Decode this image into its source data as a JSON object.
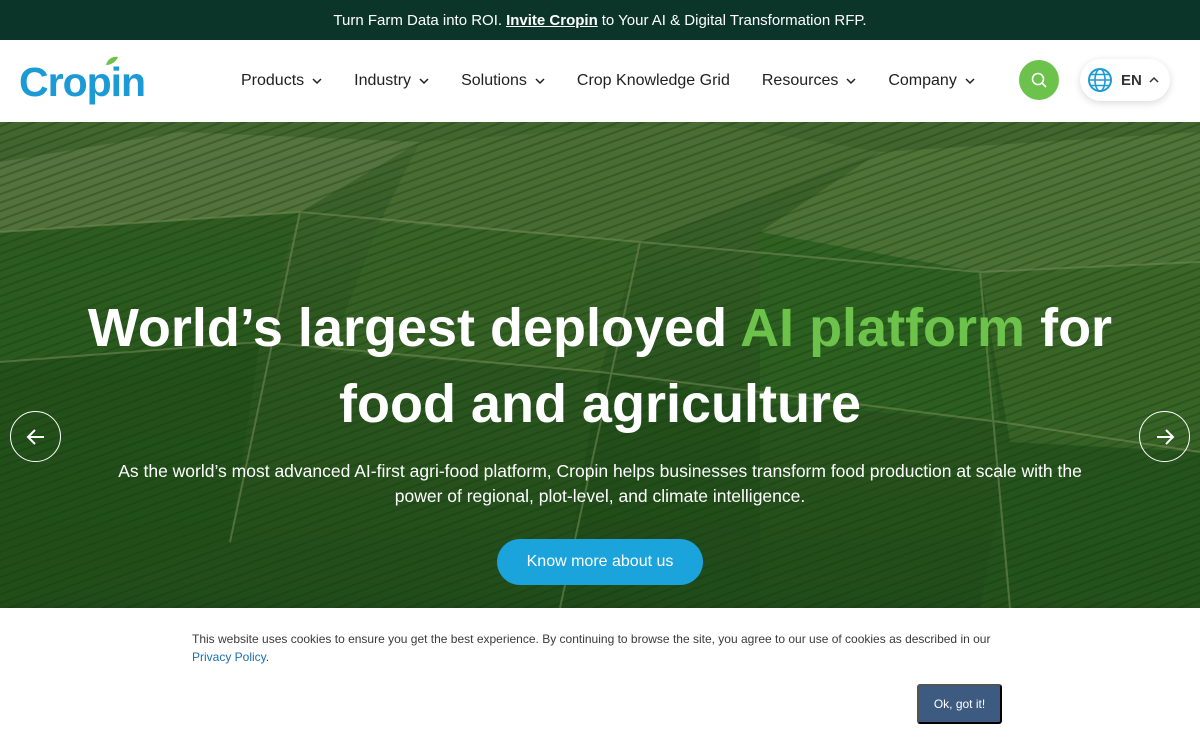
{
  "announcement": {
    "text_before": "Turn Farm Data into ROI.",
    "link_text": "Invite Cropin",
    "text_after": "to Your AI & Digital Transformation RFP."
  },
  "header": {
    "logo_text": "Cropin",
    "nav": [
      {
        "label": "Products",
        "has_dropdown": true
      },
      {
        "label": "Industry",
        "has_dropdown": true
      },
      {
        "label": "Solutions",
        "has_dropdown": true
      },
      {
        "label": "Crop Knowledge Grid",
        "has_dropdown": false
      },
      {
        "label": "Resources",
        "has_dropdown": true
      },
      {
        "label": "Company",
        "has_dropdown": true
      }
    ],
    "search_icon": "search-icon",
    "language": {
      "label": "EN",
      "icon": "globe-icon"
    }
  },
  "hero": {
    "title_part1": "World’s largest deployed",
    "title_accent": "AI platform",
    "title_part2": "for",
    "title_line2": "food and agriculture",
    "subtitle": "As the world’s most advanced AI-first agri-food platform, Cropin helps businesses transform food production at scale with the power of regional, plot-level, and climate intelligence.",
    "cta_label": "Know more about us",
    "prev_icon": "arrow-left-icon",
    "next_icon": "arrow-right-icon"
  },
  "cookie": {
    "text": "This website uses cookies to ensure you get the best experience. By continuing to browse the site, you agree to our use of cookies as described in our",
    "link_text": "Privacy Policy",
    "link_suffix": ".",
    "button_label": "Ok, got it!"
  },
  "colors": {
    "topbar_bg": "#0b3528",
    "brand_blue": "#1c9ad6",
    "brand_green": "#6cc24a",
    "cta_blue": "#1ba3db",
    "cookie_button": "#3d5a80"
  }
}
